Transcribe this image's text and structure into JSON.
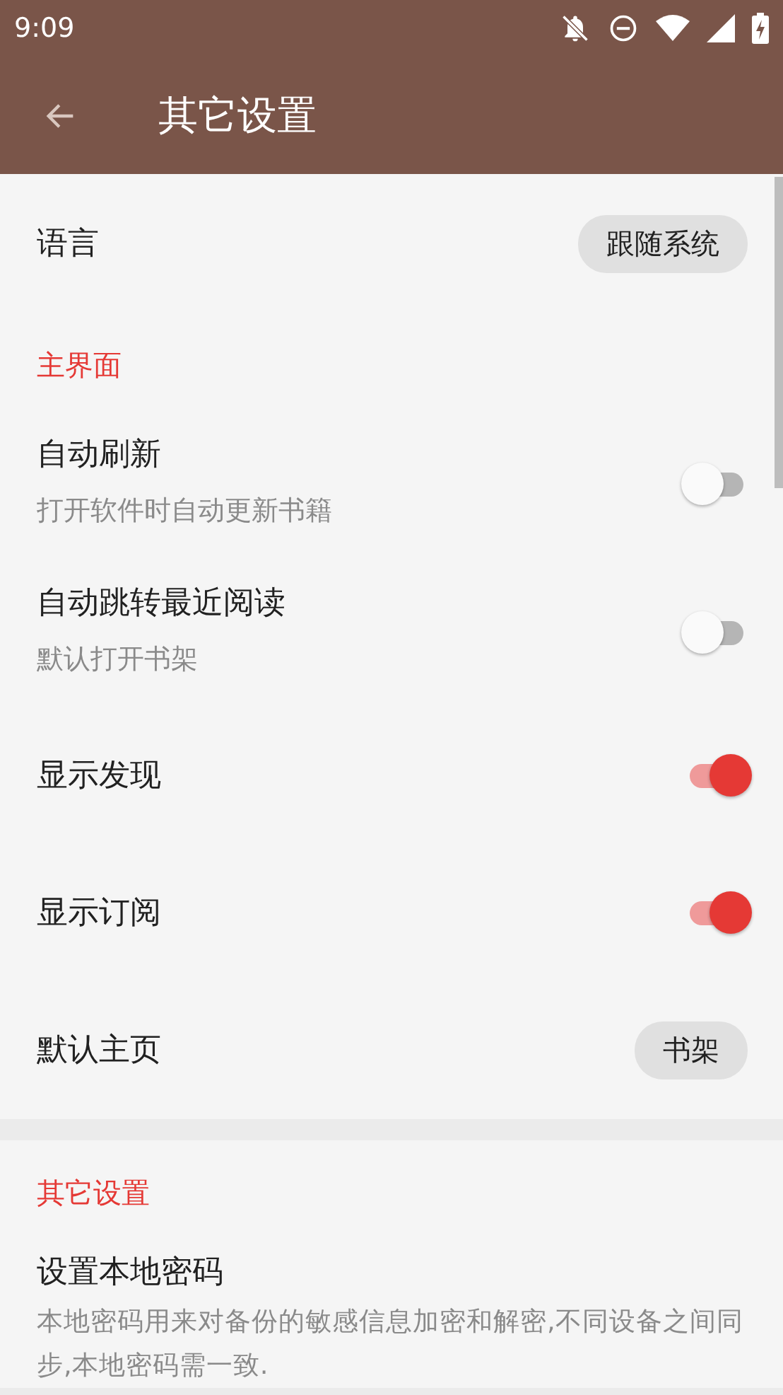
{
  "status_bar": {
    "time": "9:09"
  },
  "toolbar": {
    "title": "其它设置"
  },
  "cards": [
    {
      "items": [
        {
          "kind": "chip",
          "title": "语言",
          "value": "跟随系统"
        },
        {
          "kind": "category",
          "title": "主界面"
        },
        {
          "kind": "switch",
          "title": "自动刷新",
          "summary": "打开软件时自动更新书籍",
          "on": false
        },
        {
          "kind": "switch",
          "title": "自动跳转最近阅读",
          "summary": "默认打开书架",
          "on": false
        },
        {
          "kind": "switch",
          "title": "显示发现",
          "on": true
        },
        {
          "kind": "switch",
          "title": "显示订阅",
          "on": true
        },
        {
          "kind": "chip",
          "title": "默认主页",
          "value": "书架"
        }
      ]
    },
    {
      "items": [
        {
          "kind": "category",
          "title": "其它设置"
        },
        {
          "kind": "text",
          "title": "设置本地密码",
          "summary": "本地密码用来对备份的敏感信息加密和解密,不同设备之间同步,本地密码需一致."
        }
      ]
    }
  ]
}
